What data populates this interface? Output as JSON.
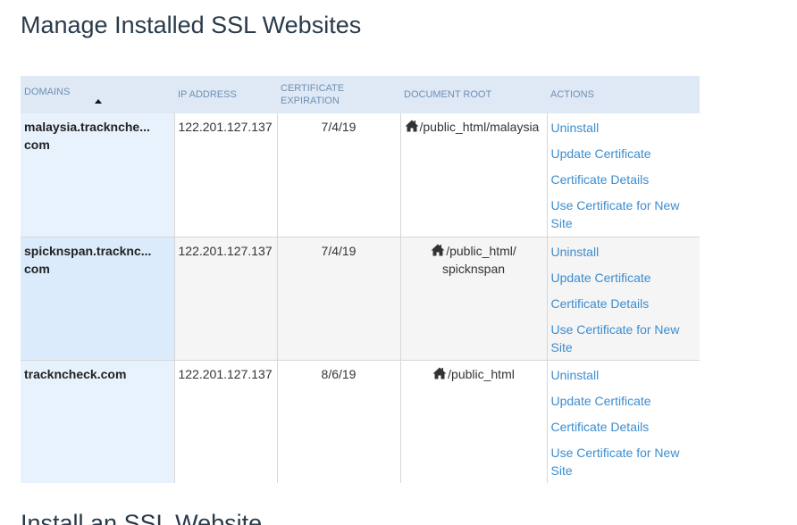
{
  "page": {
    "title": "Manage Installed SSL Websites",
    "next_section_title": "Install an SSL Website"
  },
  "table": {
    "columns": {
      "domains": "Domains",
      "ip_address": "IP Address",
      "certificate_expiration": "Certificate Expiration",
      "document_root": "Document Root",
      "actions": "Actions"
    },
    "rows": [
      {
        "domain_line1": "malaysia.tracknche...",
        "domain_line2": "com",
        "ip": "122.201.127.137",
        "expiration": "7/4/19",
        "docroot_line1": "/public_html/malaysia",
        "docroot_line2": ""
      },
      {
        "domain_line1": "spicknspan.tracknc...",
        "domain_line2": "com",
        "ip": "122.201.127.137",
        "expiration": "7/4/19",
        "docroot_line1": "/public_html/",
        "docroot_line2": "spicknspan"
      },
      {
        "domain_line1": "trackncheck.com",
        "domain_line2": "",
        "ip": "122.201.127.137",
        "expiration": "8/6/19",
        "docroot_line1": "/public_html",
        "docroot_line2": ""
      }
    ],
    "actions": {
      "uninstall": "Uninstall",
      "update_certificate": "Update Certificate",
      "certificate_details": "Certificate Details",
      "use_certificate_line1": "Use Certificate for New",
      "use_certificate_line2": "Site"
    }
  },
  "icons": {
    "home": "home-icon",
    "sort": "sort-ascending-icon"
  },
  "colors": {
    "link": "#3c8dcf",
    "header_bg": "#dfe9f6",
    "header_text": "#6e8fb2",
    "domain_bg": "#e8f2fd",
    "title": "#293a4a"
  }
}
